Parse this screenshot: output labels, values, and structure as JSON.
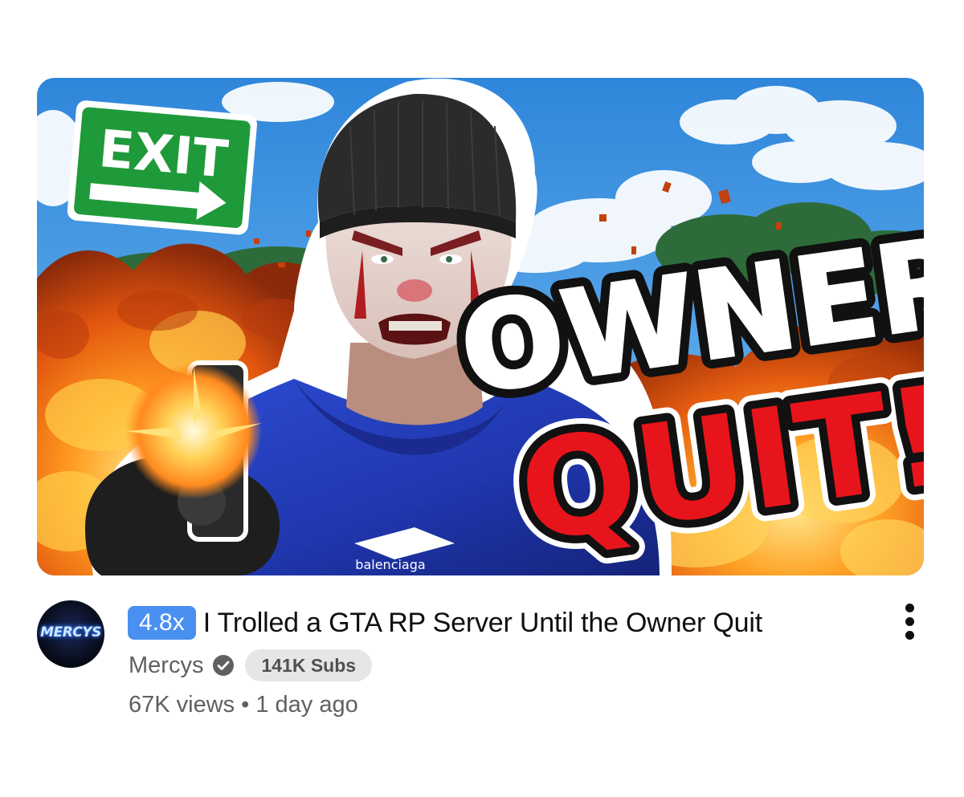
{
  "video": {
    "thumbnail": {
      "sign_text": "EXIT",
      "headline_line1": "OWNER",
      "headline_line2": "QUIT!",
      "hoodie_logo_text": "balenciaga"
    },
    "speed_badge": "4.8x",
    "title": "I Trolled a GTA RP Server Until the Owner Quit",
    "channel": {
      "name": "Mercys",
      "avatar_text": "MERCYS",
      "verified": true,
      "subs_label": "141K Subs"
    },
    "views": "67K views",
    "separator": "•",
    "age": "1 day ago"
  },
  "icons": {
    "verified": "check-circle-icon",
    "more": "vertical-dots-icon"
  },
  "colors": {
    "badge": "#4a90f0",
    "title": "#0f0f0f",
    "secondary_text": "#606060",
    "pill_bg": "#e6e6e6",
    "quit_red": "#e8141b",
    "exit_green": "#1f9a3a",
    "sky": "#3a8fdc"
  }
}
